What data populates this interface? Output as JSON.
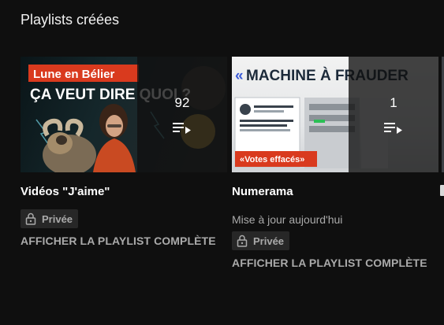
{
  "section": {
    "title": "Playlists créées"
  },
  "playlists": [
    {
      "title": "Vidéos \"J'aime\"",
      "video_count": "92",
      "updated": "",
      "privacy": "Privée",
      "action": "AFFICHER LA PLAYLIST COMPLÈTE",
      "thumbnail_text": {
        "line1": "Lune en Bélier",
        "line2": "ÇA VEUT DIRE QUOI ?"
      }
    },
    {
      "title": "Numerama",
      "video_count": "1",
      "updated": "Mise à jour aujourd'hui",
      "privacy": "Privée",
      "action": "AFFICHER LA PLAYLIST COMPLÈTE",
      "thumbnail_text": {
        "line1": "MACHINE À FRAUDER",
        "line2": "«Votes effacés»"
      }
    }
  ],
  "icons": {
    "playlist": "playlist-play-icon",
    "lock": "lock-icon"
  },
  "colors": {
    "background": "#0f0f0f",
    "text": "#f1f1f1",
    "muted": "#aaaaaa",
    "badge": "#272727",
    "thumb_red": "#d93a1e"
  }
}
